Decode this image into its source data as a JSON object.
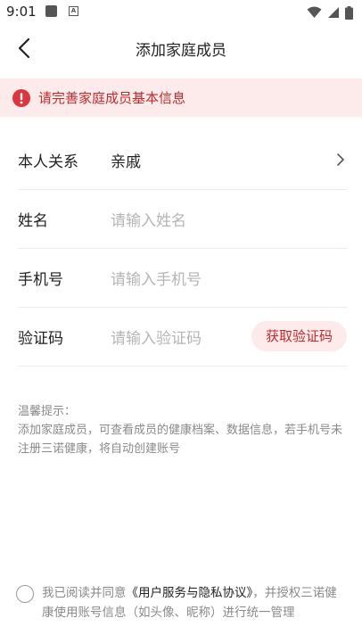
{
  "status_bar": {
    "time": "9:01",
    "a_label": "A"
  },
  "header": {
    "title": "添加家庭成员"
  },
  "notice": {
    "text": "请完善家庭成员基本信息",
    "color": "#c12b2b"
  },
  "form": {
    "relation": {
      "label": "本人关系",
      "value": "亲戚"
    },
    "name": {
      "label": "姓名",
      "placeholder": "请输入姓名"
    },
    "phone": {
      "label": "手机号",
      "placeholder": "请输入手机号"
    },
    "code": {
      "label": "验证码",
      "placeholder": "请输入验证码",
      "button": "获取验证码"
    }
  },
  "tips": {
    "title": "温馨提示：",
    "body": "添加家庭成员，可查看成员的健康档案、数据信息，若手机号未注册三诺健康，将自动创建账号"
  },
  "agreement": {
    "prefix": "我已阅读并同意",
    "link": "《用户服务与隐私协议》",
    "suffix": "，并授权三诺健康使用账号信息（如头像、昵称）进行统一管理"
  }
}
